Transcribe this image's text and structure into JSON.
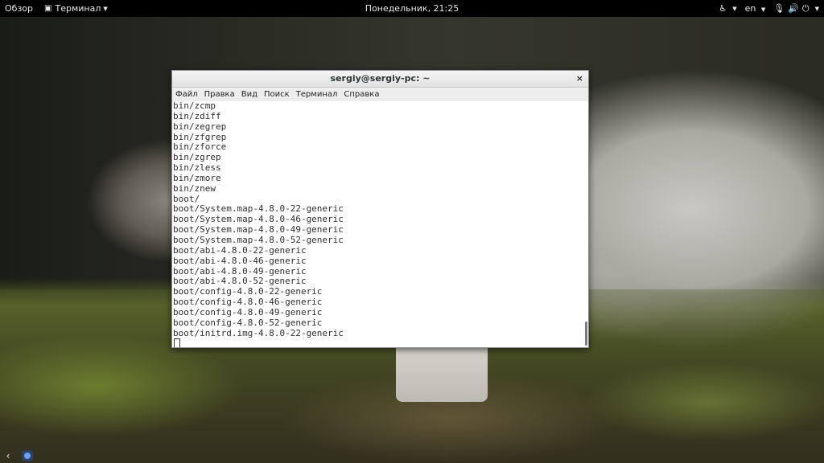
{
  "topbar": {
    "activities": "Обзор",
    "app_menu": "Терминал",
    "clock": "Понедельник, 21:25",
    "lang": "en"
  },
  "window": {
    "title": "sergiy@sergiy-pc: ~",
    "menus": [
      "Файл",
      "Правка",
      "Вид",
      "Поиск",
      "Терминал",
      "Справка"
    ],
    "lines": [
      "bin/zcmp",
      "bin/zdiff",
      "bin/zegrep",
      "bin/zfgrep",
      "bin/zforce",
      "bin/zgrep",
      "bin/zless",
      "bin/zmore",
      "bin/znew",
      "boot/",
      "boot/System.map-4.8.0-22-generic",
      "boot/System.map-4.8.0-46-generic",
      "boot/System.map-4.8.0-49-generic",
      "boot/System.map-4.8.0-52-generic",
      "boot/abi-4.8.0-22-generic",
      "boot/abi-4.8.0-46-generic",
      "boot/abi-4.8.0-49-generic",
      "boot/abi-4.8.0-52-generic",
      "boot/config-4.8.0-22-generic",
      "boot/config-4.8.0-46-generic",
      "boot/config-4.8.0-49-generic",
      "boot/config-4.8.0-52-generic",
      "boot/initrd.img-4.8.0-22-generic"
    ]
  },
  "icons": {
    "accessibility": "accessibility-icon",
    "mic": "microphone-icon",
    "volume": "volume-icon",
    "power": "power-icon"
  }
}
